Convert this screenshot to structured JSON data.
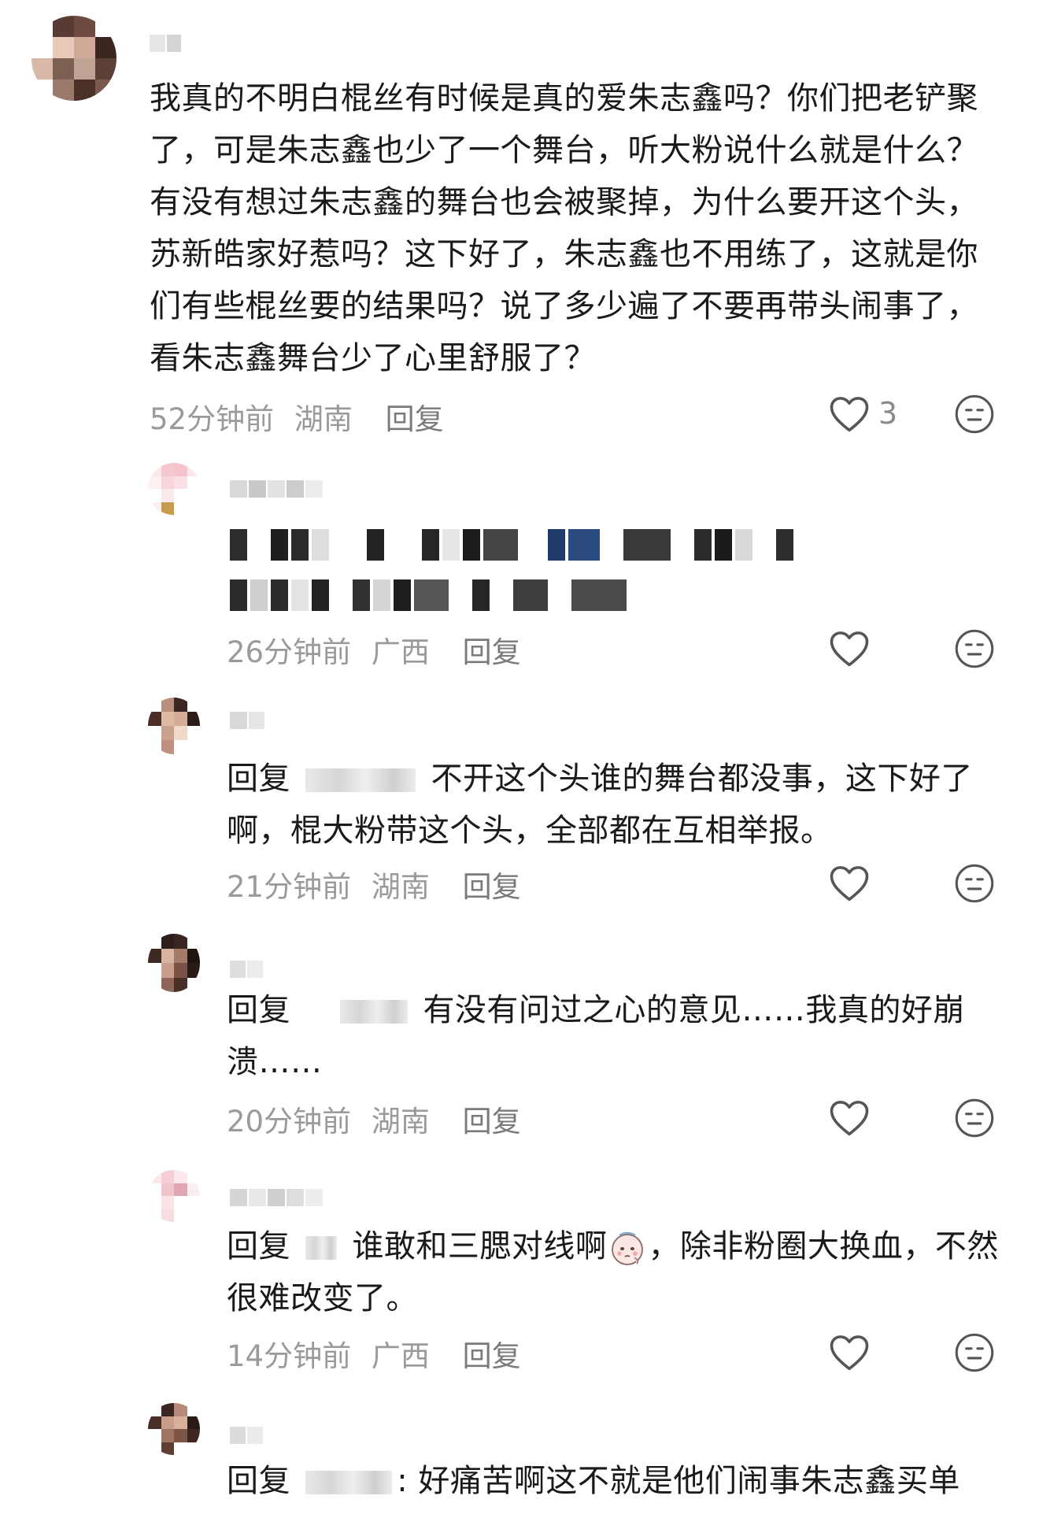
{
  "comments": [
    {
      "text": "我真的不明白棍丝有时候是真的爱朱志鑫吗？你们把老铲聚了，可是朱志鑫也少了一个舞台，听大粉说什么就是什么？有没有想过朱志鑫的舞台也会被聚掉，为什么要开这个头，苏新皓家好惹吗？这下好了，朱志鑫也不用练了，这就是你们有些棍丝要的结果吗？说了多少遍了不要再带头闹事了，看朱志鑫舞台少了心里舒服了？",
      "time": "52分钟前",
      "region": "湖南",
      "reply": "回复",
      "likes": "3"
    },
    {
      "time": "26分钟前",
      "region": "广西",
      "reply": "回复",
      "likes": ""
    },
    {
      "prefix": "回复",
      "text": "不开这个头谁的舞台都没事，这下好了啊，棍大粉带这个头，全部都在互相举报。",
      "time": "21分钟前",
      "region": "湖南",
      "reply": "回复",
      "likes": ""
    },
    {
      "prefix": "回复",
      "text": "有没有问过之心的意见……我真的好崩溃……",
      "time": "20分钟前",
      "region": "湖南",
      "reply": "回复",
      "likes": ""
    },
    {
      "prefix": "回复",
      "text_a": "谁敢和三腮对线啊",
      "text_b": "，除非粉圈大换血，不然很难改变了。",
      "time": "14分钟前",
      "region": "广西",
      "reply": "回复",
      "likes": ""
    },
    {
      "prefix": "回复",
      "text": ": 好痛苦啊这不就是他们闹事朱志鑫买单"
    }
  ],
  "icons": {
    "like": "heart-outline-icon",
    "dislike": "neutral-face-icon",
    "emoji": "crying-face-emoji-icon"
  },
  "colors": {
    "meta": "#9a9a9a",
    "text": "#1a1a1a",
    "icon": "#555555"
  }
}
